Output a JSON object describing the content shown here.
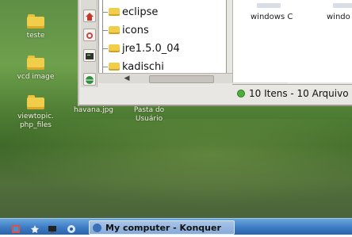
{
  "desktop": {
    "icons": [
      {
        "label": "teste"
      },
      {
        "label": "vcd image"
      },
      {
        "label": "viewtopic.\nphp_files"
      },
      {
        "label": "havana.jpg"
      },
      {
        "label": "Pasta do\nUsuário"
      }
    ]
  },
  "file_manager": {
    "tree_items": [
      {
        "label": "eclipse"
      },
      {
        "label": "icons"
      },
      {
        "label": "jre1.5.0_04"
      },
      {
        "label": "kadischi"
      }
    ],
    "content_items": [
      {
        "label": "windows C"
      },
      {
        "label": "windo"
      }
    ],
    "status_text": "10 Itens - 10 Arquivo"
  },
  "taskbar": {
    "task_button_label": "My computer - Konquer"
  },
  "colors": {
    "desktop_green": "#5e8f45",
    "taskbar_blue": "#3d7cc4",
    "folder_yellow": "#f1ce4a",
    "status_led": "#4caf3d"
  }
}
